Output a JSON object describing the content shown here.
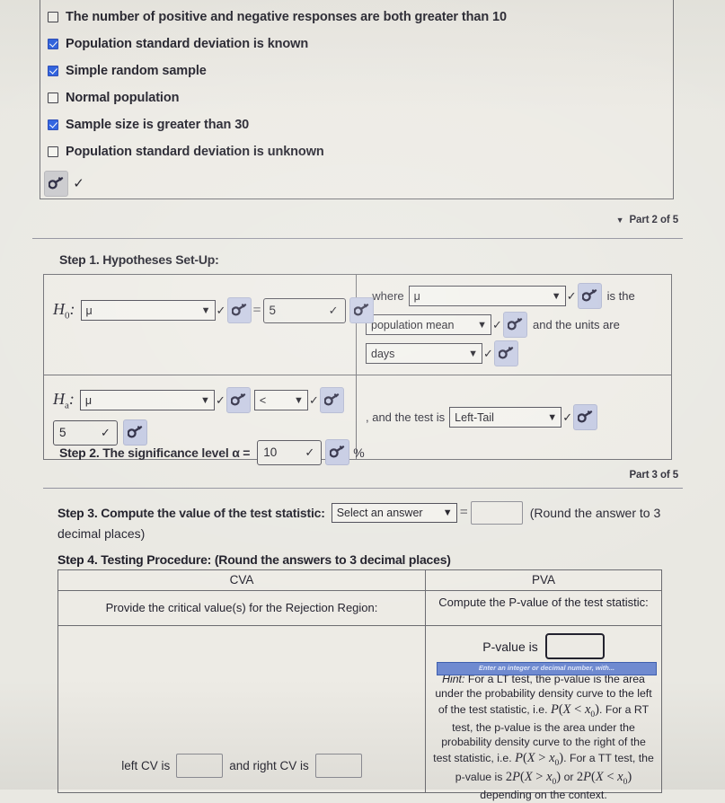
{
  "assumptions": {
    "items": [
      {
        "label": "The number of positive and negative responses are both greater than 10",
        "checked": false
      },
      {
        "label": "Population standard deviation is known",
        "checked": true
      },
      {
        "label": "Simple random sample",
        "checked": true
      },
      {
        "label": "Normal population",
        "checked": false
      },
      {
        "label": "Sample size is greater than 30",
        "checked": true
      },
      {
        "label": "Population standard deviation is unknown",
        "checked": false
      }
    ],
    "submit_icon": "key-icon",
    "submit_mark": "✓"
  },
  "parts": {
    "part2": "Part 2 of 5",
    "part3": "Part 3 of 5",
    "caret": "▼"
  },
  "step1": {
    "title": "Step 1. Hypotheses Set-Up:",
    "h0": {
      "symbol": "H",
      "sub": "0",
      "colon": ":",
      "param_select": "μ",
      "relation": "=",
      "value": "5",
      "check": "✓",
      "caret": "⌄"
    },
    "ha": {
      "symbol": "H",
      "sub": "a",
      "colon": ":",
      "param_select": "μ",
      "relation_select": "<",
      "value": "5",
      "check": "✓"
    },
    "where_prefix": ", where",
    "where_select": "μ",
    "is_the": "is the",
    "meaning_select": "population mean",
    "units_text": "and the units are",
    "units_select": "days",
    "test_prefix": ", and the test is",
    "test_select": "Left-Tail"
  },
  "step2": {
    "text_before": "Step 2. The significance level α =",
    "value": "10",
    "check": "✓",
    "percent": "%"
  },
  "step3": {
    "text_before": "Step 3. Compute the value of the test statistic:",
    "select": "Select an answer",
    "equals": "=",
    "value": "",
    "note_line1": "(Round the answer to 3",
    "note_line2": "decimal places)"
  },
  "step4": {
    "title": "Step 4. Testing Procedure: (Round the answers to 3 decimal places)",
    "headers": {
      "cva": "CVA",
      "pva": "PVA"
    },
    "cva": {
      "instruction": "Provide the critical value(s) for the Rejection Region:",
      "left_label": "left CV is",
      "left_value": "",
      "mid_label": "and right CV is",
      "right_value": ""
    },
    "pva": {
      "instruction": "Compute the P-value of the test statistic:",
      "pvalue_label": "P-value is",
      "pvalue_value": "",
      "tooltip": "Enter an integer or decimal number, with...",
      "hint_label": "Hint:",
      "hint_1": "For a LT test, the p-value is the area under the probability density curve to the left of the test statistic, i.e.",
      "hint_math_1": "P(X < x₀)",
      "hint_2": ". For a RT test, the p-value is the area under the probability density curve to the right of the test statistic, i.e.",
      "hint_math_2": "P(X > x₀)",
      "hint_3": ". For a TT test, the p-value is",
      "hint_math_3": "2P(X > x₀)",
      "hint_or": "or",
      "hint_math_4": "2P(X < x₀)",
      "hint_4": "depending on the context."
    }
  },
  "colors": {
    "page_background": "#e9e8e2",
    "panel_background": "#edebe5",
    "border": "#6d6d72",
    "checkbox_checked": "#2a5fe0",
    "key_button": "#c3c9e2",
    "tooltip": "#6f8ad0",
    "text": "#1d1c27"
  }
}
